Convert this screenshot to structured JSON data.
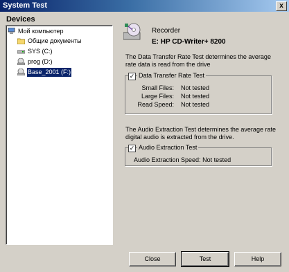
{
  "window": {
    "title": "System Test",
    "close_glyph": "x"
  },
  "devices": {
    "label": "Devices",
    "items": [
      {
        "label": "Мой компьютер",
        "icon": "computer-icon"
      },
      {
        "label": "Общие документы",
        "icon": "folder-icon"
      },
      {
        "label": "SYS (C:)",
        "icon": "hard-drive-icon"
      },
      {
        "label": "prog (D:)",
        "icon": "cd-drive-icon"
      },
      {
        "label": "Base_2001 (F:)",
        "icon": "cd-drive-icon",
        "selected": true
      }
    ]
  },
  "recorder": {
    "label": "Recorder",
    "drive": "E: HP CD-Writer+ 8200",
    "icon": "cd-recorder-icon"
  },
  "transfer": {
    "description": "The Data Transfer Rate Test determines the average rate data is read from the drive",
    "checkbox_label": "Data Transfer Rate Test",
    "checked": true,
    "rows": [
      {
        "key": "Small Files:",
        "value": "Not tested"
      },
      {
        "key": "Large Files:",
        "value": "Not tested"
      },
      {
        "key": "Read Speed:",
        "value": "Not tested"
      }
    ]
  },
  "audio": {
    "description": "The Audio Extraction Test determines the average rate digital audio is extracted from the drive.",
    "checkbox_label": "Audio Extraction Test",
    "checked": true,
    "row": {
      "key": "Audio Extraction Speed:",
      "value": "Not tested"
    }
  },
  "buttons": {
    "close": "Close",
    "test": "Test",
    "help": "Help"
  }
}
